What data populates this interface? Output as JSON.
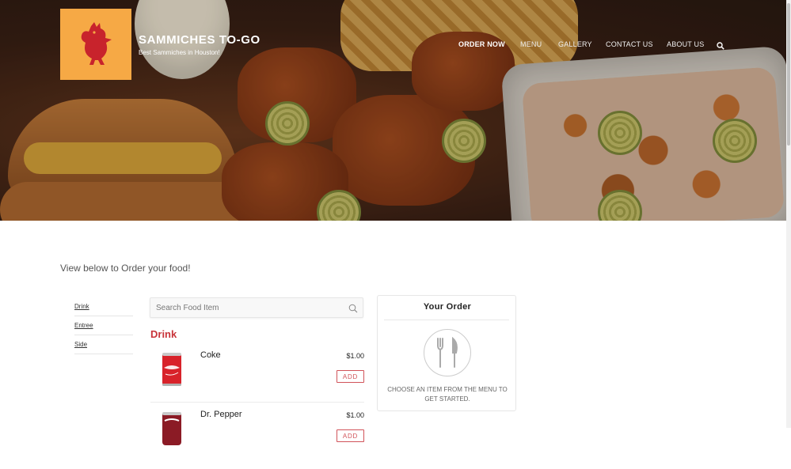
{
  "brand": {
    "title": "SAMMICHES TO-GO",
    "tagline": "Best Sammiches in Houston!",
    "logo_color": "#f6a945",
    "logo_icon": "rooster-icon"
  },
  "nav": {
    "items": [
      {
        "label": "ORDER NOW",
        "active": true
      },
      {
        "label": "MENU"
      },
      {
        "label": "GALLERY"
      },
      {
        "label": "CONTACT US"
      },
      {
        "label": "ABOUT US"
      }
    ],
    "search_icon": "search-icon"
  },
  "intro": "View below to Order your food!",
  "categories": [
    "Drink",
    "Entree",
    "Side"
  ],
  "search": {
    "placeholder": "Search Food Item"
  },
  "menu": {
    "section_title": "Drink",
    "items": [
      {
        "name": "Coke",
        "price": "$1.00",
        "add_label": "ADD"
      },
      {
        "name": "Dr. Pepper",
        "price": "$1.00",
        "add_label": "ADD"
      }
    ]
  },
  "order": {
    "title": "Your Order",
    "empty_message": "CHOOSE AN ITEM FROM THE MENU TO GET STARTED.",
    "icon": "fork-knife-icon"
  },
  "colors": {
    "accent": "#c8343a",
    "add_button": "#d15359"
  }
}
